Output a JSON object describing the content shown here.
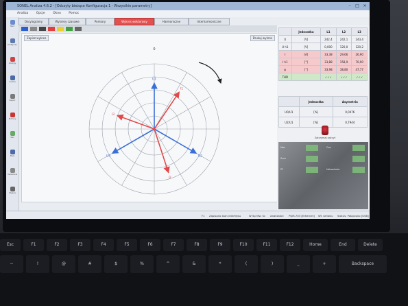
{
  "window": {
    "title": "SONEL Analiza 4.6.2 - [Odczyty bieżące Konfiguracja 1 - Wszystkie parametry]",
    "minimize": "–",
    "maximize": "□",
    "close": "×"
  },
  "menu": [
    "Analiza",
    "Opcje",
    "Okno",
    "Pomoc"
  ],
  "tabs": [
    {
      "label": "Oscylogramy",
      "active": false
    },
    {
      "label": "Wykresy czasowe",
      "active": false
    },
    {
      "label": "Pomiary",
      "active": false
    },
    {
      "label": "Wykres wektorowy",
      "active": true
    },
    {
      "label": "Harmoniczne",
      "active": false
    },
    {
      "label": "Interharmoniczne",
      "active": false
    }
  ],
  "color_swatches": [
    "#2e5fcf",
    "#888888",
    "#444444",
    "#e04040",
    "#e8d030",
    "#40a040",
    "#666666"
  ],
  "sidebar": [
    {
      "label": "Start",
      "icon": "home-icon",
      "color": "#6a8ccf"
    },
    {
      "label": "Konfiguracja",
      "icon": "wrench-icon",
      "color": "#5a7ab0"
    },
    {
      "label": "Odczyty",
      "icon": "meter-icon",
      "color": "#c44"
    },
    {
      "label": "Analiza",
      "icon": "chart-icon",
      "color": "#4a6aa8"
    },
    {
      "label": "Raport",
      "icon": "document-icon",
      "color": "#7a7a7a"
    },
    {
      "label": "Pomiary",
      "icon": "gauge-icon",
      "color": "#c33"
    },
    {
      "label": "Sieć",
      "icon": "grid-icon",
      "color": "#6a6"
    },
    {
      "label": "Bazy",
      "icon": "database-icon",
      "color": "#4a6aa8"
    },
    {
      "label": "Ustawienia",
      "icon": "gear-icon",
      "color": "#888"
    },
    {
      "label": "Wyjście",
      "icon": "exit-icon",
      "color": "#666"
    }
  ],
  "diagram": {
    "left_button": "Zapisz wykres",
    "right_button": "Drukuj wykres",
    "top_label": "0",
    "rotation": "clockwise",
    "colors": {
      "voltage": "#3a6fd8",
      "current": "#e04a4a"
    },
    "vectors": [
      {
        "label": "U1",
        "angle_deg": 0,
        "magnitude": 0.7,
        "type": "voltage"
      },
      {
        "label": "U2",
        "angle_deg": 120,
        "magnitude": 0.74,
        "type": "voltage"
      },
      {
        "label": "U3",
        "angle_deg": 240,
        "magnitude": 0.74,
        "type": "voltage"
      },
      {
        "label": "I1",
        "angle_deg": 34,
        "magnitude": 0.68,
        "type": "current"
      },
      {
        "label": "I2",
        "angle_deg": 162,
        "magnitude": 0.7,
        "type": "current"
      },
      {
        "label": "I3",
        "angle_deg": 290,
        "magnitude": 0.6,
        "type": "current"
      }
    ]
  },
  "measurements": {
    "headers": [
      "",
      "Jednostka",
      "L1",
      "L2",
      "L3"
    ],
    "rows": [
      {
        "name": "U",
        "unit": "[V]",
        "l1": "242,4",
        "l2": "242,1",
        "l3": "243,4",
        "style": ""
      },
      {
        "name": "U h1",
        "unit": "[V]",
        "l1": "0,000",
        "l2": "120,0",
        "l3": "120,2",
        "style": ""
      },
      {
        "name": "I",
        "unit": "[A]",
        "l1": "33,38",
        "l2": "29,66",
        "l3": "26,90",
        "style": "pink"
      },
      {
        "name": "I h1",
        "unit": "[°]",
        "l1": "33,88",
        "l2": "158,9",
        "l3": "70,90",
        "style": "pink"
      },
      {
        "name": "φ",
        "unit": "[°]",
        "l1": "33,98",
        "l2": "38,80",
        "l3": "47,77",
        "style": "pink"
      },
      {
        "name": "THD",
        "unit": "",
        "l1": "✓✓✓",
        "l2": "✓✓✓",
        "l3": "✓✓✓",
        "style": "green"
      }
    ]
  },
  "unbalance": {
    "headers": [
      "",
      "Jednostka",
      "Asymetria"
    ],
    "rows": [
      {
        "name": "U0/U1",
        "unit": "[%]",
        "value": "0,0476"
      },
      {
        "name": "U2/U1",
        "unit": "[%]",
        "value": "0,7944"
      }
    ]
  },
  "knob_label": "Zatrzymaj odczyt",
  "photo_labels": [
    "Moc",
    "Sum",
    "PF",
    "Cos",
    "Ustawienia"
  ],
  "statusbar": {
    "left": "F1",
    "mid1": "Zapisano stan interfejsu",
    "mid2": "W Sp Msc Sc",
    "analyzer": "Analizator:",
    "model": "PQM-703 [Ethernet]",
    "link": "Wł. serwisu",
    "right": "Status: Połączono [USB]"
  },
  "keyboard_keys": [
    "Esc",
    "F1",
    "F2",
    "F3",
    "F4",
    "F5",
    "F6",
    "F7",
    "F8",
    "F9",
    "F10",
    "F11",
    "F12",
    "Home",
    "End",
    "Delete",
    "~",
    "!",
    "@",
    "#",
    "$",
    "%",
    "^",
    "&",
    "*",
    "(",
    ")",
    "_",
    "+",
    "Backspace"
  ]
}
